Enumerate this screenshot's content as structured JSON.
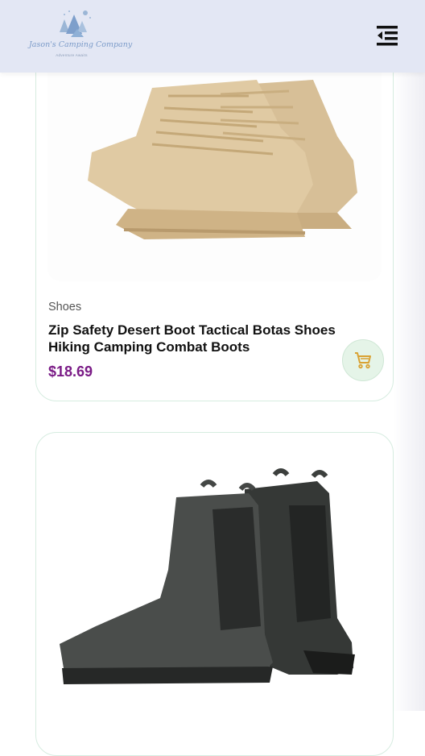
{
  "header": {
    "logo_text": "Jason's Camping Company",
    "logo_tagline": "Adventure Awaits",
    "menu_icon": "menu-collapse-icon"
  },
  "products": [
    {
      "category": "Shoes",
      "title": "Zip Safety Desert Boot Tactical Botas Shoes Hiking Camping Combat Boots",
      "price": "$18.69",
      "image": "tan-hiking-boots",
      "cart_icon": "shopping-cart-icon"
    },
    {
      "image": "black-chelsea-rain-boots"
    }
  ],
  "colors": {
    "header_bg": "#e3e7f4",
    "price": "#7a1b86",
    "cart_icon": "#d9a233",
    "cart_bg": "#e5f4e8"
  }
}
